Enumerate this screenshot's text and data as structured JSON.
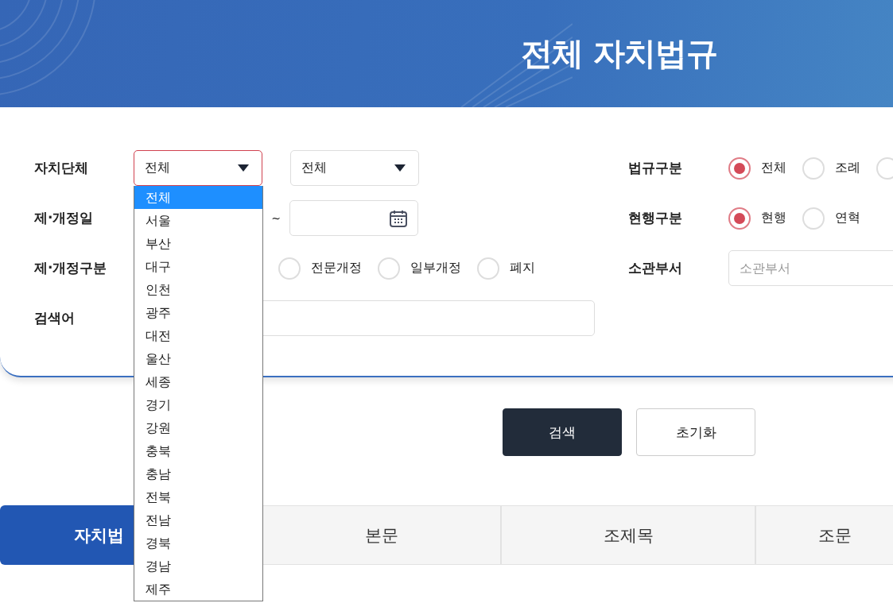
{
  "header": {
    "title": "전체 자치법규"
  },
  "form": {
    "region": {
      "label": "자치단체",
      "select_1": {
        "value": "전체",
        "expanded": true
      },
      "select_2": {
        "value": "전체",
        "expanded": false
      }
    },
    "date": {
      "label": "제·개정일",
      "separator": "~"
    },
    "revision": {
      "label": "제·개정구분",
      "options": [
        {
          "label": "전문개정",
          "selected": false
        },
        {
          "label": "일부개정",
          "selected": false
        },
        {
          "label": "폐지",
          "selected": false
        }
      ]
    },
    "keyword": {
      "label": "검색어"
    },
    "law_type": {
      "label": "법규구분",
      "options": [
        {
          "label": "전체",
          "selected": true
        },
        {
          "label": "조례",
          "selected": false
        },
        {
          "selected": false
        }
      ]
    },
    "current": {
      "label": "현행구분",
      "options": [
        {
          "label": "현행",
          "selected": true
        },
        {
          "label": "연혁",
          "selected": false
        }
      ]
    },
    "department": {
      "label": "소관부서",
      "placeholder": "소관부서"
    }
  },
  "buttons": [
    {
      "label": "검색",
      "kind": "primary"
    },
    {
      "label": "초기화",
      "kind": "secondary"
    }
  ],
  "tabs": [
    {
      "label": "자치법",
      "selected": true
    },
    {
      "label": "본문",
      "selected": false
    },
    {
      "label": "조제목",
      "selected": false
    },
    {
      "label": "조문",
      "selected": false
    }
  ],
  "dropdown": {
    "items": [
      {
        "label": "전체",
        "selected": true
      },
      {
        "label": "서울",
        "selected": false
      },
      {
        "label": "부산",
        "selected": false
      },
      {
        "label": "대구",
        "selected": false
      },
      {
        "label": "인천",
        "selected": false
      },
      {
        "label": "광주",
        "selected": false
      },
      {
        "label": "대전",
        "selected": false
      },
      {
        "label": "울산",
        "selected": false
      },
      {
        "label": "세종",
        "selected": false
      },
      {
        "label": "경기",
        "selected": false
      },
      {
        "label": "강원",
        "selected": false
      },
      {
        "label": "충북",
        "selected": false
      },
      {
        "label": "충남",
        "selected": false
      },
      {
        "label": "전북",
        "selected": false
      },
      {
        "label": "전남",
        "selected": false
      },
      {
        "label": "경북",
        "selected": false
      },
      {
        "label": "경남",
        "selected": false
      },
      {
        "label": "제주",
        "selected": false
      }
    ]
  }
}
